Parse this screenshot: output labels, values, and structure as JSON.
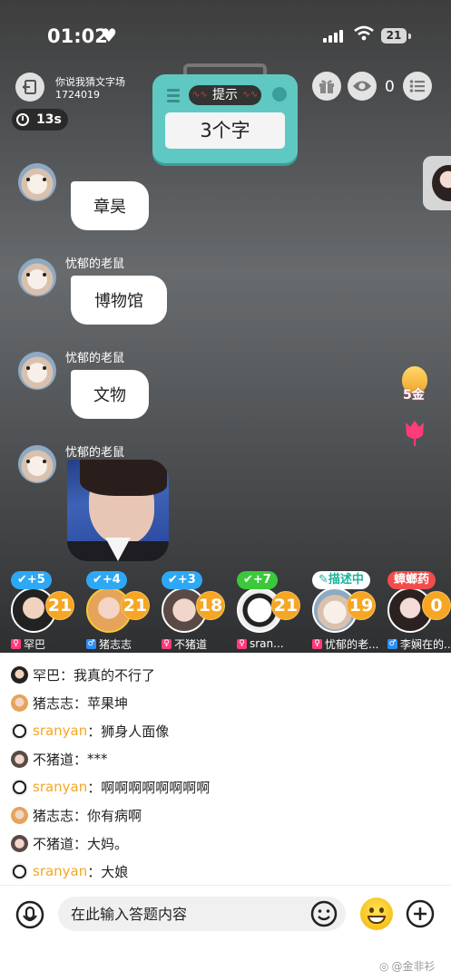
{
  "status_bar": {
    "time": "01:02",
    "heart_icon": "heart-icon",
    "battery": "21"
  },
  "room": {
    "name": "你说我猜文字场",
    "id": "1724019"
  },
  "timer": {
    "text": "13s"
  },
  "hint": {
    "label": "提示",
    "answer": "3个字"
  },
  "viewers": {
    "count": "0"
  },
  "messages": [
    {
      "name": "忧郁的老鼠",
      "text": "章昊"
    },
    {
      "name": "忧郁的老鼠",
      "text": "博物馆"
    },
    {
      "name": "忧郁的老鼠",
      "text": "文物"
    },
    {
      "name": "忧郁的老鼠",
      "image": "photo-of-young-man"
    }
  ],
  "gifts": {
    "egg_label": "5金"
  },
  "players": [
    {
      "badge": "+5",
      "score": "21",
      "name": "罕巴",
      "badge_color": "#2ea8f5",
      "gender": "female"
    },
    {
      "badge": "+4",
      "score": "21",
      "name": "猪志志",
      "badge_color": "#2ea8f5",
      "gender": "male"
    },
    {
      "badge": "+3",
      "score": "18",
      "name": "不猪道",
      "badge_color": "#2ea8f5",
      "gender": "female"
    },
    {
      "badge": "+7",
      "score": "21",
      "name": "sran...",
      "badge_color": "#3bc93b",
      "gender": "female"
    },
    {
      "badge": "描述中",
      "score": "19",
      "name": "忧郁的老...",
      "badge_color": "#ffffff",
      "gender": "female"
    },
    {
      "badge": "蟑螂药",
      "score": "0",
      "name": "李娴在的...",
      "badge_color": "#f24c4c",
      "gender": "male"
    }
  ],
  "chat": [
    {
      "name": "罕巴",
      "text": "我真的不行了",
      "highlight": false
    },
    {
      "name": "猪志志",
      "text": "苹果坤",
      "highlight": false
    },
    {
      "name": "sranyan",
      "text": "狮身人面像",
      "highlight": true
    },
    {
      "name": "不猪道",
      "text": "***",
      "highlight": false
    },
    {
      "name": "sranyan",
      "text": "啊啊啊啊啊啊啊啊",
      "highlight": true
    },
    {
      "name": "猪志志",
      "text": "你有病啊",
      "highlight": false
    },
    {
      "name": "不猪道",
      "text": "大妈。",
      "highlight": false
    },
    {
      "name": "sranyan",
      "text": "大娘",
      "highlight": true
    }
  ],
  "chat_separator": "：",
  "input": {
    "placeholder": "在此输入答题内容"
  },
  "watermark": "@金非衫"
}
